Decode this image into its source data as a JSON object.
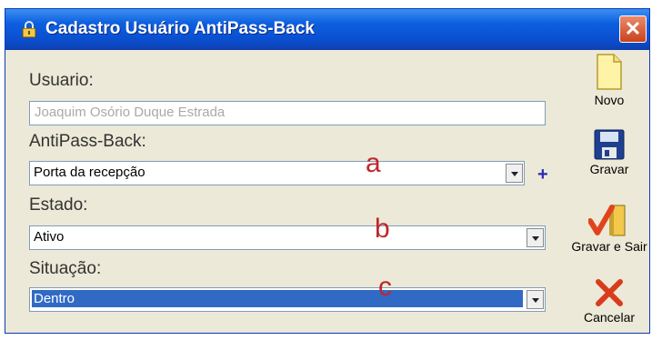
{
  "window": {
    "title": "Cadastro Usuário AntiPass-Back",
    "close_glyph": "✕"
  },
  "form": {
    "usuario": {
      "label": "Usuario:",
      "value": "Joaquim Osório Duque Estrada"
    },
    "antipassback": {
      "label": "AntiPass-Back:",
      "value": "Porta da recepção",
      "add_glyph": "+"
    },
    "estado": {
      "label": "Estado:",
      "value": "Ativo"
    },
    "situacao": {
      "label": "Situação:",
      "value": "Dentro"
    }
  },
  "annotations": {
    "a": "a",
    "b": "b",
    "c": "c"
  },
  "toolbar": {
    "novo": {
      "label": "Novo",
      "icon": "new-document-icon"
    },
    "gravar": {
      "label": "Gravar",
      "icon": "floppy-disk-icon"
    },
    "gravar_sair": {
      "label": "Gravar e Sair",
      "icon": "save-exit-icon"
    },
    "cancelar": {
      "label": "Cancelar",
      "icon": "cancel-x-icon"
    }
  },
  "colors": {
    "titlebar": "#0a4fd0",
    "selection": "#316ac5",
    "annotation": "#c0262a",
    "face": "#ece9d8"
  }
}
